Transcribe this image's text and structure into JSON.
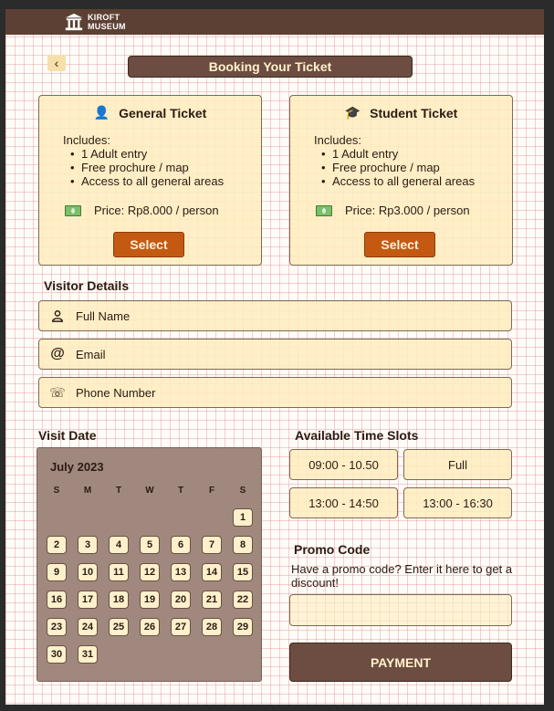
{
  "header": {
    "logo_line1": "KIROFT",
    "logo_line2": "MUSEUM"
  },
  "page": {
    "title": "Booking Your Ticket",
    "back_icon": "‹"
  },
  "tickets": [
    {
      "title": "General Ticket",
      "icon": "👤",
      "includes_label": "Includes:",
      "items": [
        "1 Adult entry",
        "Free prochure / map",
        "Access to all general areas"
      ],
      "price": "Price: Rp8.000 / person",
      "button": "Select"
    },
    {
      "title": "Student Ticket",
      "icon": "🎓",
      "includes_label": "Includes:",
      "items": [
        "1 Adult entry",
        "Free prochure / map",
        "Access to all general areas"
      ],
      "price": "Price: Rp3.000 / person",
      "button": "Select"
    }
  ],
  "visitor": {
    "title": "Visitor Details",
    "fields": [
      {
        "placeholder": "Full Name",
        "icon": "👤"
      },
      {
        "placeholder": "Email",
        "icon": "@"
      },
      {
        "placeholder": "Phone Number",
        "icon": "☏"
      }
    ]
  },
  "visit_date": {
    "title": "Visit Date",
    "month": "July 2023",
    "weekdays": [
      "S",
      "M",
      "T",
      "W",
      "T",
      "F",
      "S"
    ],
    "days": [
      "1",
      "2",
      "3",
      "4",
      "5",
      "6",
      "7",
      "8",
      "9",
      "10",
      "11",
      "12",
      "13",
      "14",
      "15",
      "16",
      "17",
      "18",
      "19",
      "20",
      "21",
      "22",
      "23",
      "24",
      "25",
      "26",
      "27",
      "28",
      "29",
      "30",
      "31"
    ]
  },
  "time_slots": {
    "title": "Available Time Slots",
    "slots": [
      "09:00 - 10.50",
      "Full",
      "13:00 - 14:50",
      "13:00 - 16:30"
    ]
  },
  "promo": {
    "title": "Promo Code",
    "description": "Have a promo code? Enter it here to get a discount!",
    "placeholder": ""
  },
  "payment_button": "PAYMENT",
  "colors": {
    "header_bg": "#5c4033",
    "card_bg": "#ffecbe",
    "accent_orange": "#c45a12",
    "calendar_bg": "#a1887f",
    "button_brown": "#6d4c41"
  }
}
